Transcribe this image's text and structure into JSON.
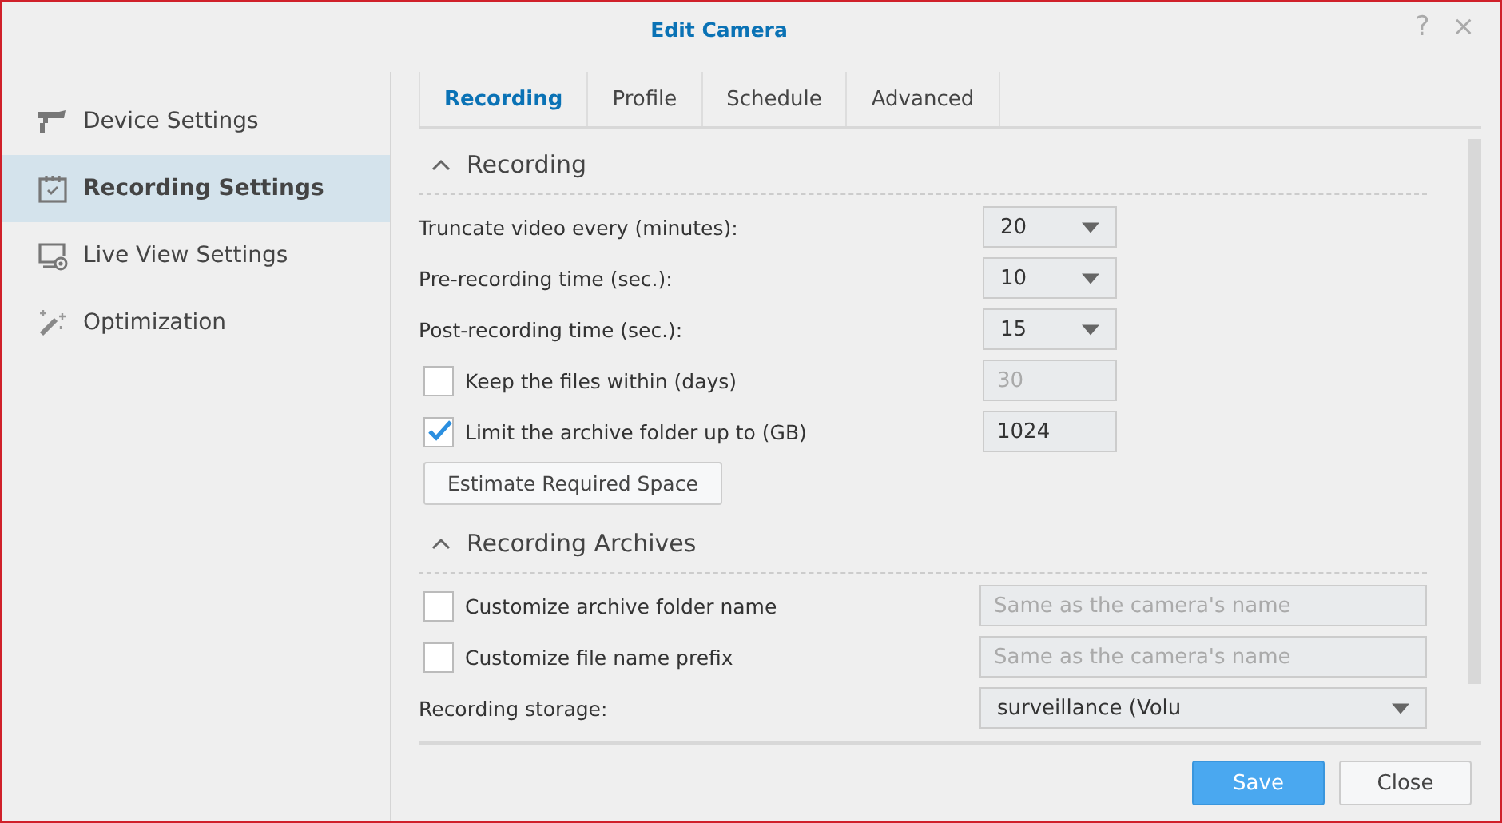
{
  "window": {
    "title": "Edit Camera",
    "help": "?",
    "close": "×"
  },
  "sidebar": {
    "items": [
      {
        "label": "Device Settings",
        "selected": false
      },
      {
        "label": "Recording Settings",
        "selected": true
      },
      {
        "label": "Live View Settings",
        "selected": false
      },
      {
        "label": "Optimization",
        "selected": false
      }
    ]
  },
  "tabs": [
    {
      "label": "Recording",
      "selected": true
    },
    {
      "label": "Profile",
      "selected": false
    },
    {
      "label": "Schedule",
      "selected": false
    },
    {
      "label": "Advanced",
      "selected": false
    }
  ],
  "sections": [
    {
      "title": "Recording",
      "expanded": true,
      "rows": [
        {
          "kind": "select",
          "label": "Truncate video every (minutes):",
          "value": "20"
        },
        {
          "kind": "select",
          "label": "Pre-recording time (sec.):",
          "value": "10"
        },
        {
          "kind": "select",
          "label": "Post-recording time (sec.):",
          "value": "15"
        },
        {
          "kind": "check",
          "label": "Keep the files within (days)",
          "checked": false,
          "value": "30",
          "disabled": true
        },
        {
          "kind": "check",
          "label": "Limit the archive folder up to (GB)",
          "checked": true,
          "value": "1024",
          "disabled": false
        },
        {
          "kind": "button",
          "label": "Estimate Required Space"
        }
      ]
    },
    {
      "title": "Recording Archives",
      "expanded": true,
      "rows": [
        {
          "kind": "check",
          "label": "Customize archive folder name",
          "checked": false,
          "placeholder": "Same as the camera's name",
          "disabled": true,
          "wide": true
        },
        {
          "kind": "check",
          "label": "Customize file name prefix",
          "checked": false,
          "placeholder": "Same as the camera's name",
          "disabled": true,
          "wide": true
        },
        {
          "kind": "select",
          "label": "Recording storage:",
          "value": "surveillance (Volu",
          "wide": true
        }
      ]
    }
  ],
  "buttons": [
    {
      "label": "Save",
      "primary": true
    },
    {
      "label": "Close",
      "primary": false
    }
  ]
}
